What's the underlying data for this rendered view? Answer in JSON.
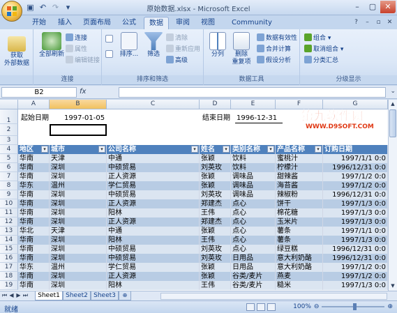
{
  "window": {
    "title": "原始数据.xlsx - Microsoft Excel",
    "controls": [
      "minimize",
      "maximize",
      "close"
    ]
  },
  "ribbon": {
    "tabs": [
      {
        "label": "开始"
      },
      {
        "label": "插入"
      },
      {
        "label": "页面布局"
      },
      {
        "label": "公式"
      },
      {
        "label": "数据",
        "active": true
      },
      {
        "label": "审阅"
      },
      {
        "label": "视图"
      },
      {
        "label": "Community Clips"
      }
    ],
    "groups": {
      "external": {
        "label": "",
        "get_external": "获取\n外部数据"
      },
      "connections": {
        "label": "连接",
        "refresh_all": "全部刷新",
        "connections": "连接",
        "properties": "属性",
        "edit_links": "编辑链接"
      },
      "sort_filter": {
        "label": "排序和筛选",
        "sort": "排序...",
        "filter": "筛选",
        "clear": "清除",
        "reapply": "重新应用",
        "advanced": "高级"
      },
      "data_tools": {
        "label": "数据工具",
        "text_to_columns": "分列",
        "remove_duplicates": "删除\n重复项",
        "validation": "数据有效性",
        "consolidate": "合并计算",
        "what_if": "假设分析"
      },
      "outline": {
        "label": "分级显示",
        "group": "组合",
        "ungroup": "取消组合",
        "subtotal": "分类汇总"
      }
    }
  },
  "formula_bar": {
    "name_box": "B2",
    "fx": "fx",
    "value": ""
  },
  "sheet": {
    "columns": [
      "A",
      "B",
      "C",
      "D",
      "E",
      "F",
      "G"
    ],
    "selected_column": "B",
    "row1": {
      "a": "起始日期",
      "b": "1997-01-05",
      "d": "结束日期",
      "e": "1996-12-31"
    },
    "header_row": [
      "地区",
      "城市",
      "公司名称",
      "姓名",
      "类别名称",
      "产品名称",
      "订购日期"
    ],
    "rows": [
      {
        "n": "5",
        "cells": [
          "华南",
          "天津",
          "中通",
          "张颖",
          "饮料",
          "蜜桃汁",
          "1997/1/1 0:0"
        ]
      },
      {
        "n": "6",
        "cells": [
          "华南",
          "深圳",
          "中硕贸易",
          "刘英玫",
          "饮料",
          "柠檬汁",
          "1996/12/31 0:0"
        ]
      },
      {
        "n": "7",
        "cells": [
          "华南",
          "深圳",
          "正人资源",
          "张颖",
          "调味品",
          "甜辣酱",
          "1997/1/2 0:0"
        ]
      },
      {
        "n": "8",
        "cells": [
          "华东",
          "温州",
          "学仁贸易",
          "张颖",
          "调味品",
          "海苔酱",
          "1997/1/2 0:0"
        ]
      },
      {
        "n": "9",
        "cells": [
          "华南",
          "深圳",
          "中硕贸易",
          "刘英玫",
          "调味品",
          "辣椒粉",
          "1996/12/31 0:0"
        ]
      },
      {
        "n": "10",
        "cells": [
          "华南",
          "深圳",
          "正人资源",
          "郑建杰",
          "点心",
          "饼干",
          "1997/1/3 0:0"
        ]
      },
      {
        "n": "11",
        "cells": [
          "华南",
          "深圳",
          "阳林",
          "王伟",
          "点心",
          "棉花糖",
          "1997/1/3 0:0"
        ]
      },
      {
        "n": "12",
        "cells": [
          "华南",
          "深圳",
          "正人资源",
          "郑建杰",
          "点心",
          "玉米片",
          "1997/1/3 0:0"
        ]
      },
      {
        "n": "13",
        "cells": [
          "华北",
          "天津",
          "中通",
          "张颖",
          "点心",
          "薯条",
          "1997/1/1 0:0"
        ]
      },
      {
        "n": "14",
        "cells": [
          "华南",
          "深圳",
          "阳林",
          "王伟",
          "点心",
          "薯条",
          "1997/1/3 0:0"
        ]
      },
      {
        "n": "15",
        "cells": [
          "华南",
          "深圳",
          "中硕贸易",
          "刘英玫",
          "点心",
          "绿豆糕",
          "1996/12/31 0:0"
        ]
      },
      {
        "n": "16",
        "cells": [
          "华南",
          "深圳",
          "中硕贸易",
          "刘英玫",
          "日用品",
          "意大利奶酪",
          "1996/12/31 0:0"
        ]
      },
      {
        "n": "17",
        "cells": [
          "华东",
          "温州",
          "学仁贸易",
          "张颖",
          "日用品",
          "意大利奶酪",
          "1997/1/2 0:0"
        ]
      },
      {
        "n": "18",
        "cells": [
          "华南",
          "深圳",
          "正人资源",
          "张颖",
          "谷类/麦片",
          "燕麦",
          "1997/1/2 0:0"
        ]
      },
      {
        "n": "19",
        "cells": [
          "华南",
          "深圳",
          "阳林",
          "王伟",
          "谷类/麦片",
          "糙米",
          "1997/1/3 0:0"
        ]
      }
    ],
    "tabs": [
      "Sheet1",
      "Sheet2",
      "Sheet3"
    ],
    "active_tab": "Sheet1"
  },
  "status": {
    "text": "就绪",
    "zoom": "100%",
    "zoom_fraction": 0.5
  },
  "watermark": {
    "main": "第九软件网",
    "sub": "WWW.D9SOFT.COM"
  }
}
